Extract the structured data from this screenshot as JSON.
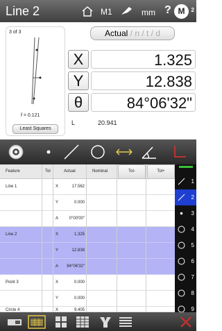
{
  "header": {
    "title": "Line 2",
    "mode": "M1",
    "units": "mm",
    "help": "?",
    "m2": "M",
    "m2_sup": "2"
  },
  "preview": {
    "count": "3 of 3",
    "f_value": "f = 0.121",
    "least_squares": "Least Squares"
  },
  "actual_tabs": {
    "active": "Actual",
    "rest": " / n / t / d"
  },
  "coords": [
    {
      "axis": "X",
      "value": "1.325"
    },
    {
      "axis": "Y",
      "value": "12.838"
    },
    {
      "axis": "θ",
      "value": "84°06'32\""
    }
  ],
  "length": {
    "label": "L",
    "value": "20.941"
  },
  "toolbar": {
    "icons": [
      "target-icon",
      "point-icon",
      "line-icon",
      "circle-icon",
      "distance-icon",
      "angle-icon",
      "datum-icon"
    ],
    "accent": "#e53030"
  },
  "table": {
    "headers": {
      "feature": "Feature",
      "tol": "Tol",
      "actual": "Actual",
      "nominal": "Nominal",
      "tol_minus": "Tol-",
      "tol_plus": "Tol+"
    },
    "rows": [
      {
        "feature": "Line 1",
        "axis": "X",
        "actual": "17.562",
        "selected": false
      },
      {
        "feature": "",
        "axis": "Y",
        "actual": "0.000",
        "selected": false
      },
      {
        "feature": "",
        "axis": "A",
        "actual": "0°00'00\"",
        "selected": false
      },
      {
        "feature": "Line 2",
        "axis": "X",
        "actual": "1.325",
        "selected": true
      },
      {
        "feature": "",
        "axis": "Y",
        "actual": "12.838",
        "selected": true
      },
      {
        "feature": "",
        "axis": "A",
        "actual": "84°06'32\"",
        "selected": true
      },
      {
        "feature": "Point 3",
        "axis": "X",
        "actual": "0.000",
        "selected": false
      },
      {
        "feature": "",
        "axis": "Y",
        "actual": "0.000",
        "selected": false
      },
      {
        "feature": "Circle 4",
        "axis": "X",
        "actual": "9.405",
        "selected": false
      }
    ]
  },
  "feature_list": [
    {
      "num": "1",
      "icon": "line-icon",
      "selected": false
    },
    {
      "num": "2",
      "icon": "line-icon",
      "selected": true
    },
    {
      "num": "3",
      "icon": "point-icon",
      "selected": false
    },
    {
      "num": "4",
      "icon": "circle-icon",
      "selected": false
    },
    {
      "num": "5",
      "icon": "circle-icon",
      "selected": false
    },
    {
      "num": "6",
      "icon": "circle-icon",
      "selected": false
    },
    {
      "num": "7",
      "icon": "circle-icon",
      "selected": false
    },
    {
      "num": "8",
      "icon": "circle-icon",
      "selected": false
    },
    {
      "num": "9",
      "icon": "circle-icon",
      "selected": false
    }
  ],
  "bottom_bar": {
    "icons": [
      "view-mode-icon",
      "table-view-icon",
      "grid-icon",
      "spreadsheet-icon",
      "tolerance-icon",
      "list-icon",
      "delete-icon"
    ],
    "delete_color": "#c03030",
    "highlight": "#e6c84a"
  }
}
